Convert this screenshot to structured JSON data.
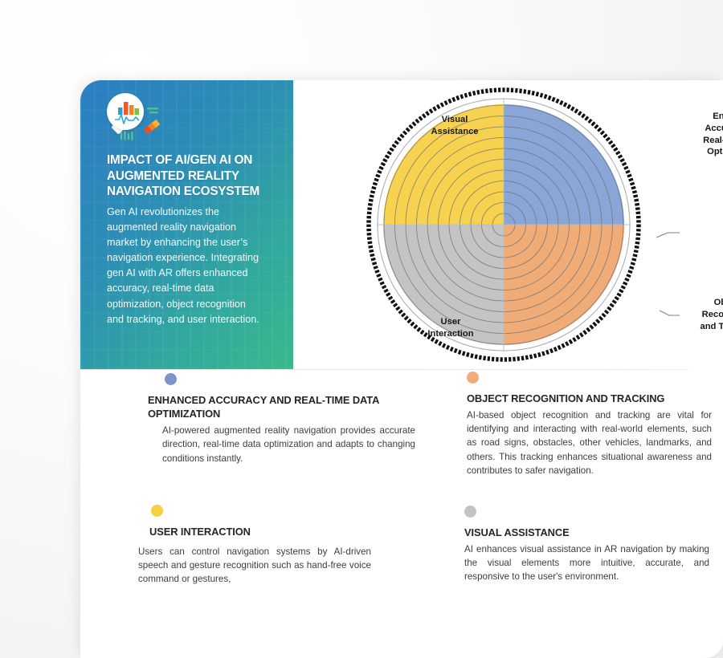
{
  "hero": {
    "icon": "analytics-chart-icon",
    "title": "IMPACT OF AI/GEN AI ON AUGMENTED REALITY NAVIGATION ECOSYSTEM",
    "body": "Gen AI revolutionizes the augmented reality navigation market by enhancing the user’s navigation experience. Integrating gen AI with AR offers enhanced accuracy, real-time data optimization, object recognition and tracking, and user interaction."
  },
  "chart_data": {
    "type": "pie",
    "title": "",
    "categories": [
      "Enhanced Accuracy and Real-time Data Optimization",
      "Object Recognition and Tracking",
      "User Interaction",
      "Visual Assistance"
    ],
    "values": [
      25,
      25,
      25,
      25
    ],
    "colors": [
      "#8aa6d6",
      "#f0ab77",
      "#c4c4c4",
      "#f7d24f"
    ],
    "rings": 11,
    "grid": true,
    "legend": "none",
    "labels": [
      {
        "text": "Enhanced\nAccuracy and\nReal-time Data\nOptimization",
        "quadrant": "top-right"
      },
      {
        "text": "Object\nRecognition\nand Tracking",
        "quadrant": "bottom-right"
      },
      {
        "text": "Visual\nAssistance",
        "quadrant": "top-left"
      },
      {
        "text": "User\nInteraction",
        "quadrant": "bottom-left"
      }
    ]
  },
  "features": [
    {
      "id": "enhanced-accuracy",
      "dot_color": "#7f93c8",
      "title": "ENHANCED ACCURACY AND REAL-TIME DATA OPTIMIZATION",
      "body": "AI-powered augmented reality navigation provides accurate direction, real-time data optimization and adapts to changing conditions instantly."
    },
    {
      "id": "object-recognition",
      "dot_color": "#f0ac7c",
      "title": "OBJECT RECOGNITION AND TRACKING",
      "body": "AI-based object recognition and tracking are vital for identifying and interacting with real-world elements, such as road signs, obstacles, other vehicles, landmarks, and others. This tracking enhances situational awareness and contributes to safer navigation."
    },
    {
      "id": "user-interaction",
      "dot_color": "#f5d13f",
      "title": "USER INTERACTION",
      "body": "Users can control navigation systems by AI-driven speech and gesture recognition such as hand-free voice command or gestures,"
    },
    {
      "id": "visual-assistance",
      "dot_color": "#c3c3c3",
      "title": "VISUAL ASSISTANCE",
      "body": "AI enhances visual assistance in AR navigation by making the visual elements more intuitive, accurate, and responsive to the user's environment."
    }
  ]
}
